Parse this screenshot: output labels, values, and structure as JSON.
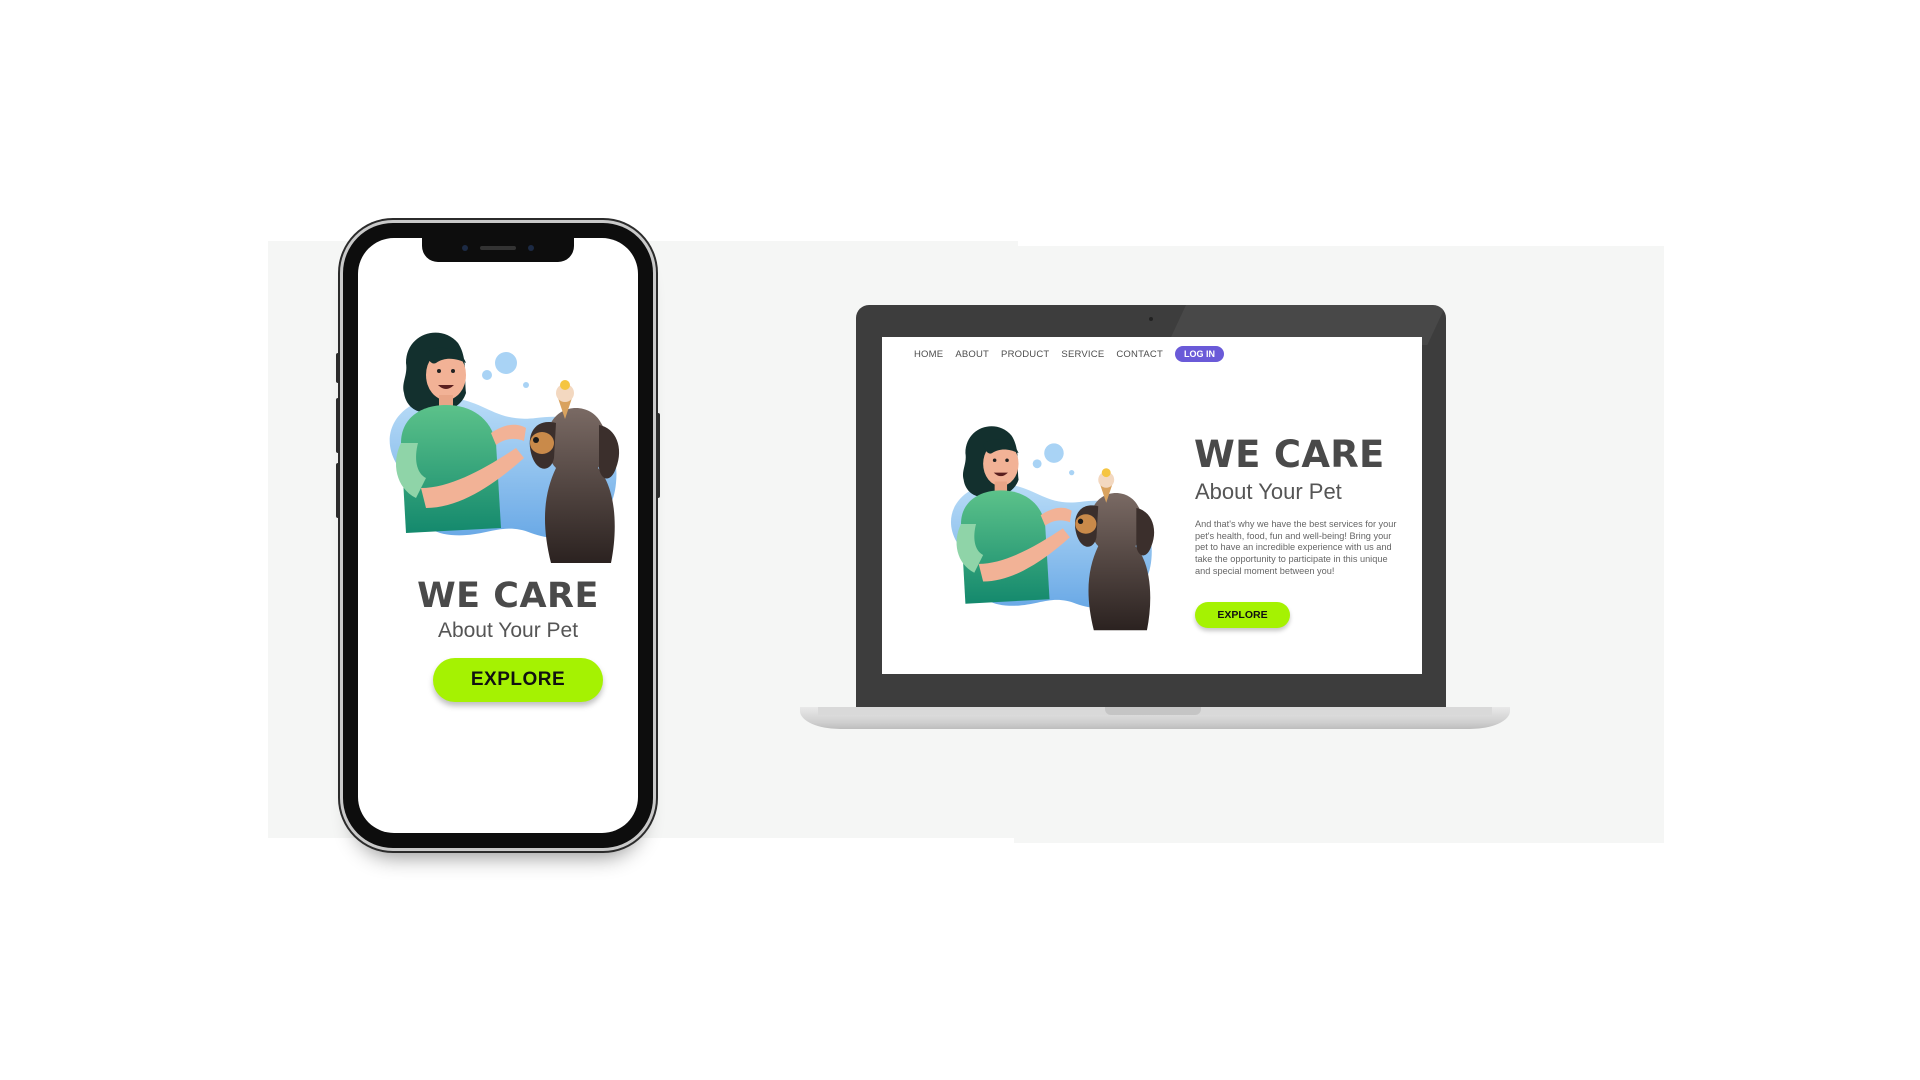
{
  "mobile": {
    "title": "WE CARE",
    "subtitle": "About Your Pet",
    "explore_label": "EXPLORE"
  },
  "desktop": {
    "nav": {
      "home": "HOME",
      "about": "ABOUT",
      "product": "PRODUCT",
      "service": "SERVICE",
      "contact": "CONTACT",
      "login": "LOG IN"
    },
    "hero": {
      "title": "WE CARE",
      "subtitle": "About Your Pet",
      "body": "And that's why we have the best services for your pet's health, food, fun and well-being! Bring your pet to have an incredible experience with us and take the opportunity to participate in this unique and special moment between you!",
      "explore_label": "EXPLORE"
    }
  },
  "colors": {
    "accent_green": "#a5f202",
    "login_purple": "#6a5ad8",
    "heading_gray": "#4a4a4a",
    "blob_blue": "#8fc3ef",
    "shirt_teal": "#2aa77a"
  },
  "icons": [
    "woman-with-dog-illustration",
    "phone-device",
    "laptop-device"
  ]
}
